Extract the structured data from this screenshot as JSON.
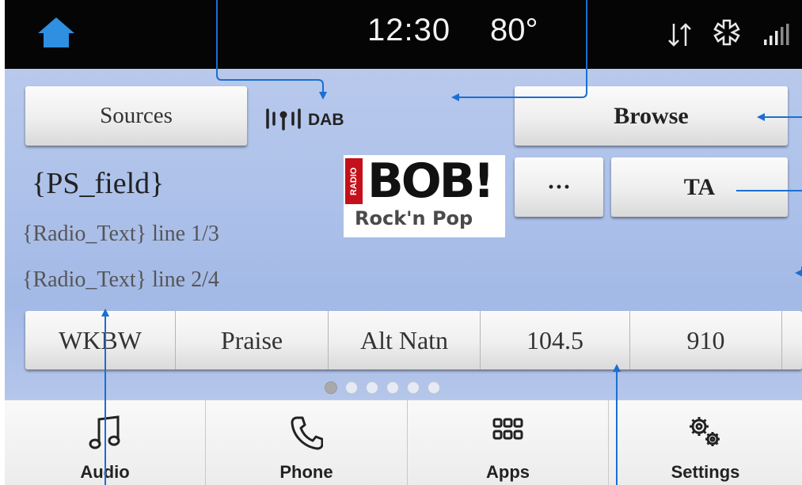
{
  "status_bar": {
    "time": "12:30",
    "temperature": "80°",
    "icons": [
      "home-icon",
      "data-transfer-icon",
      "asterisk-icon",
      "signal-bars-icon"
    ]
  },
  "main": {
    "sources_label": "Sources",
    "dab_label": "DAB",
    "browse_label": "Browse",
    "more_label": "···",
    "ta_label": "TA",
    "ps_field": "{PS_field}",
    "radio_text_1": "{Radio_Text} line 1/3",
    "radio_text_2": "{Radio_Text} line 2/4",
    "station_logo": {
      "side_text": "RADIO",
      "main_text": "BOB!",
      "sub_text": "Rock'n Pop"
    }
  },
  "presets": [
    "WKBW",
    "Praise",
    "Alt Natn",
    "104.5",
    "910"
  ],
  "page_indicator": {
    "pages": 6,
    "active": 0
  },
  "bottom_nav": [
    {
      "label": "Audio",
      "icon": "music-note-icon"
    },
    {
      "label": "Phone",
      "icon": "phone-icon"
    },
    {
      "label": "Apps",
      "icon": "apps-grid-icon"
    },
    {
      "label": "Settings",
      "icon": "gears-icon"
    }
  ],
  "colors": {
    "status_bar": "#050505",
    "home_icon": "#2f8fe0",
    "annotation_line": "#1a6fd1",
    "main_background": "#aec2ea"
  }
}
